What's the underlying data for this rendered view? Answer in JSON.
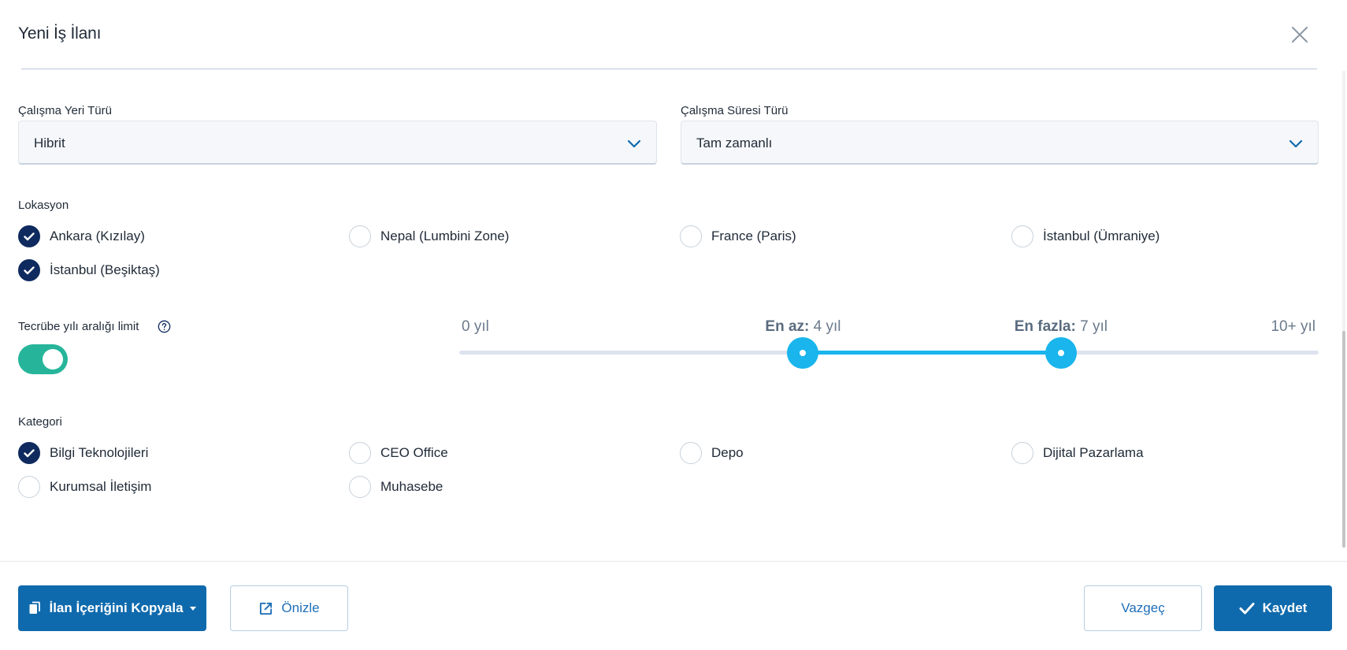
{
  "modal": {
    "title": "Yeni İş İlanı",
    "close_icon": "close-icon"
  },
  "work_place": {
    "label": "Çalışma Yeri Türü",
    "value": "Hibrit"
  },
  "work_duration": {
    "label": "Çalışma Süresi Türü",
    "value": "Tam zamanlı"
  },
  "location": {
    "label": "Lokasyon",
    "options": [
      {
        "label": "Ankara (Kızılay)",
        "checked": true
      },
      {
        "label": "Nepal (Lumbini Zone)",
        "checked": false
      },
      {
        "label": "France (Paris)",
        "checked": false
      },
      {
        "label": "İstanbul (Ümraniye)",
        "checked": false
      },
      {
        "label": "İstanbul (Beşiktaş)",
        "checked": true
      }
    ]
  },
  "experience": {
    "label": "Tecrübe yılı aralığı limit",
    "help_icon": "help-circle-icon",
    "toggle_on": true,
    "min_label": "0 yıl",
    "max_label": "10+ yıl",
    "low_prefix": "En az:",
    "low_value": "4 yıl",
    "high_prefix": "En fazla:",
    "high_value": "7 yıl",
    "range_min": 0,
    "range_max": 10,
    "low": 4,
    "high": 7
  },
  "category": {
    "label": "Kategori",
    "options": [
      {
        "label": "Bilgi Teknolojileri",
        "checked": true
      },
      {
        "label": "CEO Office",
        "checked": false
      },
      {
        "label": "Depo",
        "checked": false
      },
      {
        "label": "Dijital Pazarlama",
        "checked": false
      },
      {
        "label": "Kurumsal İletişim",
        "checked": false
      },
      {
        "label": "Muhasebe",
        "checked": false
      }
    ]
  },
  "footer": {
    "copy_label": "İlan İçeriğini Kopyala",
    "preview_label": "Önizle",
    "cancel_label": "Vazgeç",
    "save_label": "Kaydet"
  },
  "colors": {
    "primary": "#0f6aad",
    "checked": "#0e2a5e",
    "toggle_on": "#26b59a",
    "slider": "#19b5ec"
  }
}
